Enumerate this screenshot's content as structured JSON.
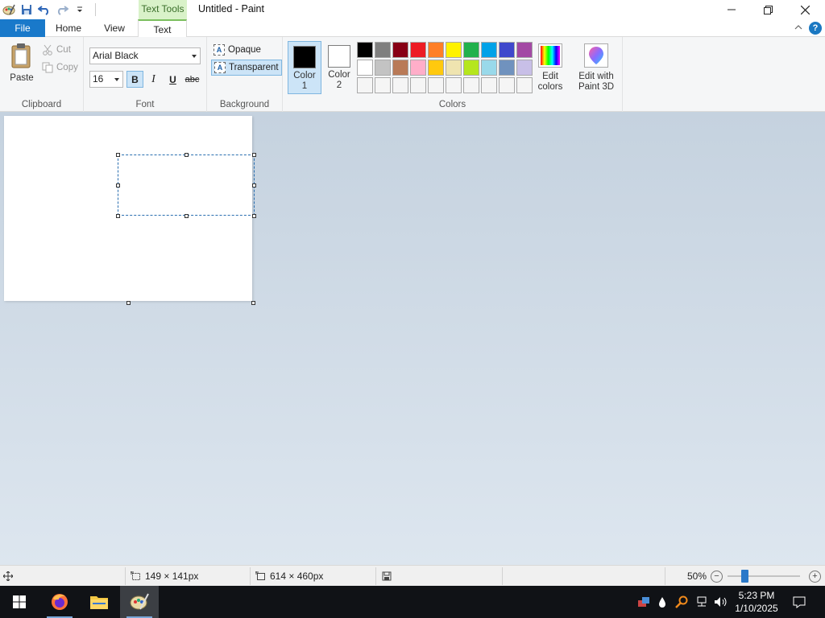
{
  "titlebar": {
    "context_tab": "Text Tools",
    "title": "Untitled - Paint",
    "quick_access": [
      "paint-app-icon",
      "save-icon",
      "undo-icon",
      "redo-icon",
      "customize-qat-icon"
    ],
    "window_controls": [
      "minimize-icon",
      "restore-icon",
      "close-icon"
    ]
  },
  "tabs": {
    "file": "File",
    "home": "Home",
    "view": "View",
    "text": "Text",
    "active": "Text"
  },
  "help_label": "?",
  "ribbon": {
    "clipboard": {
      "label": "Clipboard",
      "paste": "Paste",
      "cut": "Cut",
      "copy": "Copy"
    },
    "font": {
      "label": "Font",
      "family": "Arial Black",
      "size": "16",
      "bold": "B",
      "italic": "I",
      "underline": "U",
      "strikethrough": "abc",
      "bold_active": true
    },
    "background": {
      "label": "Background",
      "opaque": "Opaque",
      "transparent": "Transparent",
      "selected": "Transparent",
      "icon_letter": "A"
    },
    "colors": {
      "label": "Colors",
      "color1_label": "Color 1",
      "color1": "#000000",
      "color2_label": "Color 2",
      "color2": "#ffffff",
      "palette": [
        [
          "#000000",
          "#7f7f7f",
          "#880015",
          "#ed1c24",
          "#ff7f27",
          "#fff200",
          "#22b14c",
          "#00a2e8",
          "#3f48cc",
          "#a349a4"
        ],
        [
          "#ffffff",
          "#c3c3c3",
          "#b97a57",
          "#ffaec9",
          "#ffc90e",
          "#efe4b0",
          "#b5e61d",
          "#99d9ea",
          "#7092be",
          "#c8bfe7"
        ],
        [
          "#f5f5f5",
          "#f5f5f5",
          "#f5f5f5",
          "#f5f5f5",
          "#f5f5f5",
          "#f5f5f5",
          "#f5f5f5",
          "#f5f5f5",
          "#f5f5f5",
          "#f5f5f5"
        ]
      ],
      "edit_colors": "Edit colors",
      "edit_paint3d": "Edit with Paint 3D"
    }
  },
  "status": {
    "selection_size": "149 × 141px",
    "canvas_size": "614 × 460px",
    "zoom": "50%",
    "zoom_level_fraction": 0.23
  },
  "taskbar": {
    "apps": [
      "windows-start-icon",
      "firefox-icon",
      "file-explorer-icon",
      "paint-icon"
    ],
    "time": "5:23 PM",
    "date": "1/10/2025"
  }
}
